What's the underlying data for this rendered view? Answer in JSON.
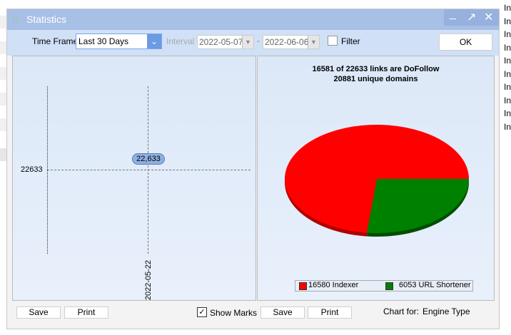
{
  "window": {
    "title": "Statistics",
    "minimize": "_",
    "maximize": "↗",
    "close": "✕"
  },
  "toolbar": {
    "time_frame_label": "Time Frame",
    "time_frame_value": "Last 30 Days",
    "interval_label": "Interval",
    "date_from": "2022-05-07",
    "date_sep": "-",
    "date_to": "2022-06-06",
    "filter_label": "Filter",
    "ok_label": "OK"
  },
  "left_chart": {
    "y_value_label": "22633",
    "point_label": "22,633",
    "x_label": "2022-05-22"
  },
  "left_footer": {
    "save": "Save",
    "print": "Print",
    "show_marks": "Show Marks",
    "show_marks_checked": true
  },
  "right_footer": {
    "save": "Save",
    "print": "Print",
    "chart_for_label": "Chart for:",
    "chart_for_value": "Engine Type"
  },
  "background_list": [
    "In",
    "In",
    "In",
    "In",
    "In",
    "In",
    "In",
    "In",
    "In",
    "In"
  ],
  "chart_data": {
    "type": "pie",
    "title": "16581 of 22633 links are DoFollow",
    "subtitle": "20881 unique domains",
    "slices": [
      {
        "name": "Indexer",
        "value": 16580,
        "label": "16580 Indexer",
        "color": "#ff0000"
      },
      {
        "name": "URL Shortener",
        "value": 6053,
        "label": "6053 URL Shortener",
        "color": "#008000"
      }
    ],
    "legend_position": "bottom"
  }
}
